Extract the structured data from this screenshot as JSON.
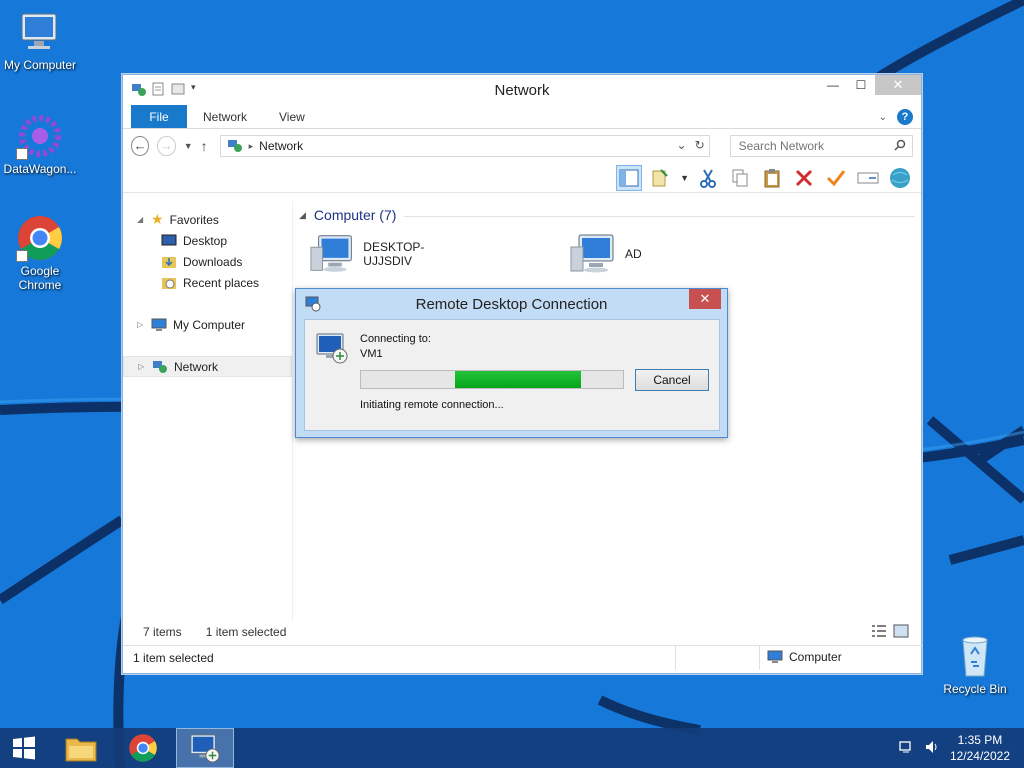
{
  "desktop": {
    "icons": [
      {
        "label": "My Computer"
      },
      {
        "label": "DataWagon..."
      },
      {
        "label": "Google Chrome"
      },
      {
        "label": "Recycle Bin"
      }
    ]
  },
  "explorer": {
    "title": "Network",
    "ribbon_tabs": {
      "file": "File",
      "network": "Network",
      "view": "View"
    },
    "address": {
      "path": "Network"
    },
    "search": {
      "placeholder": "Search Network"
    },
    "nav": {
      "favorites": "Favorites",
      "desktop": "Desktop",
      "downloads": "Downloads",
      "recent": "Recent places",
      "my_computer": "My Computer",
      "network": "Network"
    },
    "group": {
      "label": "Computer (7)"
    },
    "items": [
      "DESKTOP-UJJSDIV",
      "AD"
    ],
    "status": {
      "count": "7 items",
      "selected": "1 item selected"
    },
    "details_bar": {
      "selected": "1 item selected",
      "zone": "Computer"
    }
  },
  "rdp_dialog": {
    "title": "Remote Desktop Connection",
    "connecting_label": "Connecting to:",
    "host": "VM1",
    "status": "Initiating remote connection...",
    "cancel": "Cancel",
    "progress_start": 0.36,
    "progress_end": 0.84
  },
  "taskbar": {
    "time": "1:35 PM",
    "date": "12/24/2022"
  },
  "colors": {
    "accent": "#1979ca",
    "progress": "#06b025",
    "close_red": "#c75050"
  }
}
